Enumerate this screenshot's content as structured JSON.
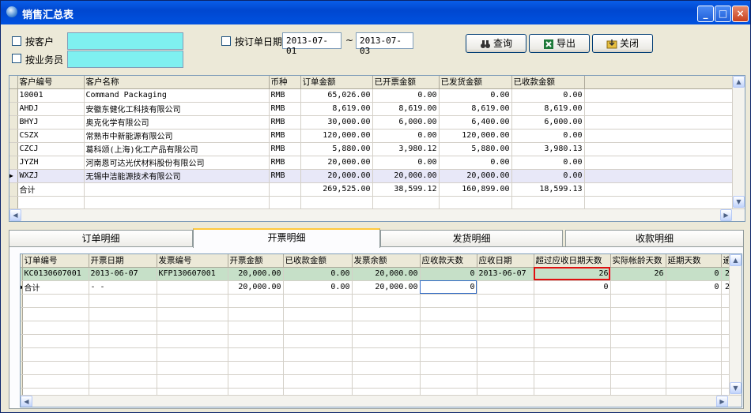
{
  "window": {
    "title": "销售汇总表"
  },
  "filters": {
    "by_customer": "按客户",
    "by_salesperson": "按业务员",
    "by_order_date": "按订单日期",
    "date_from": "2013-07-01",
    "date_sep": "~",
    "date_to": "2013-07-03"
  },
  "buttons": {
    "query": "查询",
    "export": "导出",
    "close": "关闭"
  },
  "summary_grid": {
    "columns": [
      "客户编号",
      "客户名称",
      "币种",
      "订单金额",
      "已开票金额",
      "已发货金额",
      "已收款金额"
    ],
    "rows": [
      [
        "10001",
        "Command Packaging",
        "RMB",
        "65,026.00",
        "0.00",
        "0.00",
        "0.00"
      ],
      [
        "AHDJ",
        "安徽东健化工科技有限公司",
        "RMB",
        "8,619.00",
        "8,619.00",
        "8,619.00",
        "8,619.00"
      ],
      [
        "BHYJ",
        "奥克化学有限公司",
        "RMB",
        "30,000.00",
        "6,000.00",
        "6,400.00",
        "6,000.00"
      ],
      [
        "CSZX",
        "常熟市中新能源有限公司",
        "RMB",
        "120,000.00",
        "0.00",
        "120,000.00",
        "0.00"
      ],
      [
        "CZCJ",
        "葛科颂(上海)化工产品有限公司",
        "RMB",
        "5,880.00",
        "3,980.12",
        "5,880.00",
        "3,980.13"
      ],
      [
        "JYZH",
        "河南恩可达光伏材料股份有限公司",
        "RMB",
        "20,000.00",
        "0.00",
        "0.00",
        "0.00"
      ],
      [
        "WXZJ",
        "无锡中洁能源技术有限公司",
        "RMB",
        "20,000.00",
        "20,000.00",
        "20,000.00",
        "0.00"
      ]
    ],
    "total_row": [
      "合计",
      "",
      "",
      "269,525.00",
      "38,599.12",
      "160,899.00",
      "18,599.13"
    ]
  },
  "tabs": [
    "订单明细",
    "开票明细",
    "发货明细",
    "收款明细"
  ],
  "detail_grid": {
    "columns": [
      "订单编号",
      "开票日期",
      "发票编号",
      "开票金额",
      "已收款金额",
      "发票余额",
      "应收款天数",
      "应收日期",
      "超过应收日期天数",
      "实际帐龄天数",
      "延期天数",
      "逾"
    ],
    "rows": [
      [
        "KC0130607001",
        "2013-06-07",
        "KFP130607001",
        "20,000.00",
        "0.00",
        "20,000.00",
        "0",
        "2013-06-07",
        "26",
        "26",
        "0",
        "2"
      ]
    ],
    "total_row": [
      "合计",
      "- -",
      "",
      "20,000.00",
      "0.00",
      "20,000.00",
      "0",
      "",
      "0",
      "",
      "0",
      "2"
    ]
  }
}
